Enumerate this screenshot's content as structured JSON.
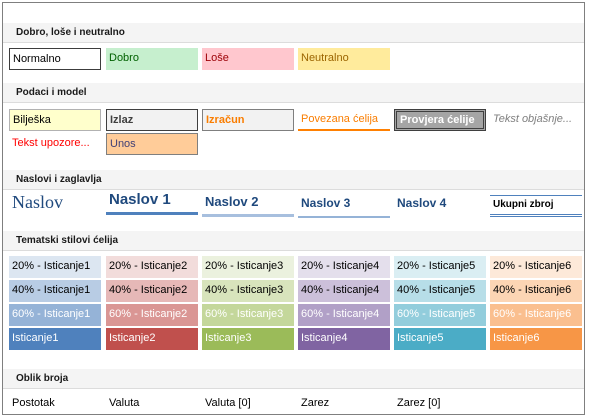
{
  "sections": {
    "good_bad": "Dobro, loše i neutralno",
    "data_model": "Podaci i model",
    "headings": "Naslovi i zaglavlja",
    "themed": "Tematski stilovi ćelija",
    "number_format": "Oblik broja"
  },
  "good_bad": {
    "normal": "Normalno",
    "good": "Dobro",
    "bad": "Loše",
    "neutral": "Neutralno"
  },
  "data_model": {
    "note": "Bilješka",
    "output": "Izlaz",
    "calculation": "Izračun",
    "linked": "Povezana ćelija",
    "check": "Provjera ćelije",
    "explanatory": "Tekst objašnje...",
    "warning": "Tekst upozore...",
    "input": "Unos"
  },
  "headings": {
    "title": "Naslov",
    "h1": "Naslov 1",
    "h2": "Naslov 2",
    "h3": "Naslov 3",
    "h4": "Naslov 4",
    "total": "Ukupni zbroj"
  },
  "themed": {
    "rows": [
      [
        "20% - Isticanje1",
        "20% - Isticanje2",
        "20% - Isticanje3",
        "20% - Isticanje4",
        "20% - Isticanje5",
        "20% - Isticanje6"
      ],
      [
        "40% - Isticanje1",
        "40% - Isticanje2",
        "40% - Isticanje3",
        "40% - Isticanje4",
        "40% - Isticanje5",
        "40% - Isticanje6"
      ],
      [
        "60% - Isticanje1",
        "60% - Isticanje2",
        "60% - Isticanje3",
        "60% - Isticanje4",
        "60% - Isticanje5",
        "60% - Isticanje6"
      ],
      [
        "Isticanje1",
        "Isticanje2",
        "Isticanje3",
        "Isticanje4",
        "Isticanje5",
        "Isticanje6"
      ]
    ],
    "colors": [
      [
        "#dce6f1",
        "#f2dcdb",
        "#ebf1de",
        "#e4dfec",
        "#daeef3",
        "#fde9d9"
      ],
      [
        "#b8cce4",
        "#e6b8b7",
        "#d8e4bc",
        "#ccc0da",
        "#b7dee8",
        "#fcd5b4"
      ],
      [
        "#95b3d7",
        "#da9694",
        "#c4d79b",
        "#b1a0c7",
        "#92cddc",
        "#fabf8f"
      ],
      [
        "#4f81bd",
        "#c0504d",
        "#9bbb59",
        "#8064a2",
        "#4bacc6",
        "#f79646"
      ]
    ],
    "text_colors": [
      "#000000",
      "#000000",
      "#ffffff",
      "#ffffff"
    ]
  },
  "number_format": {
    "percent": "Postotak",
    "currency": "Valuta",
    "currency0": "Valuta [0]",
    "comma": "Zarez",
    "comma0": "Zarez [0]"
  }
}
